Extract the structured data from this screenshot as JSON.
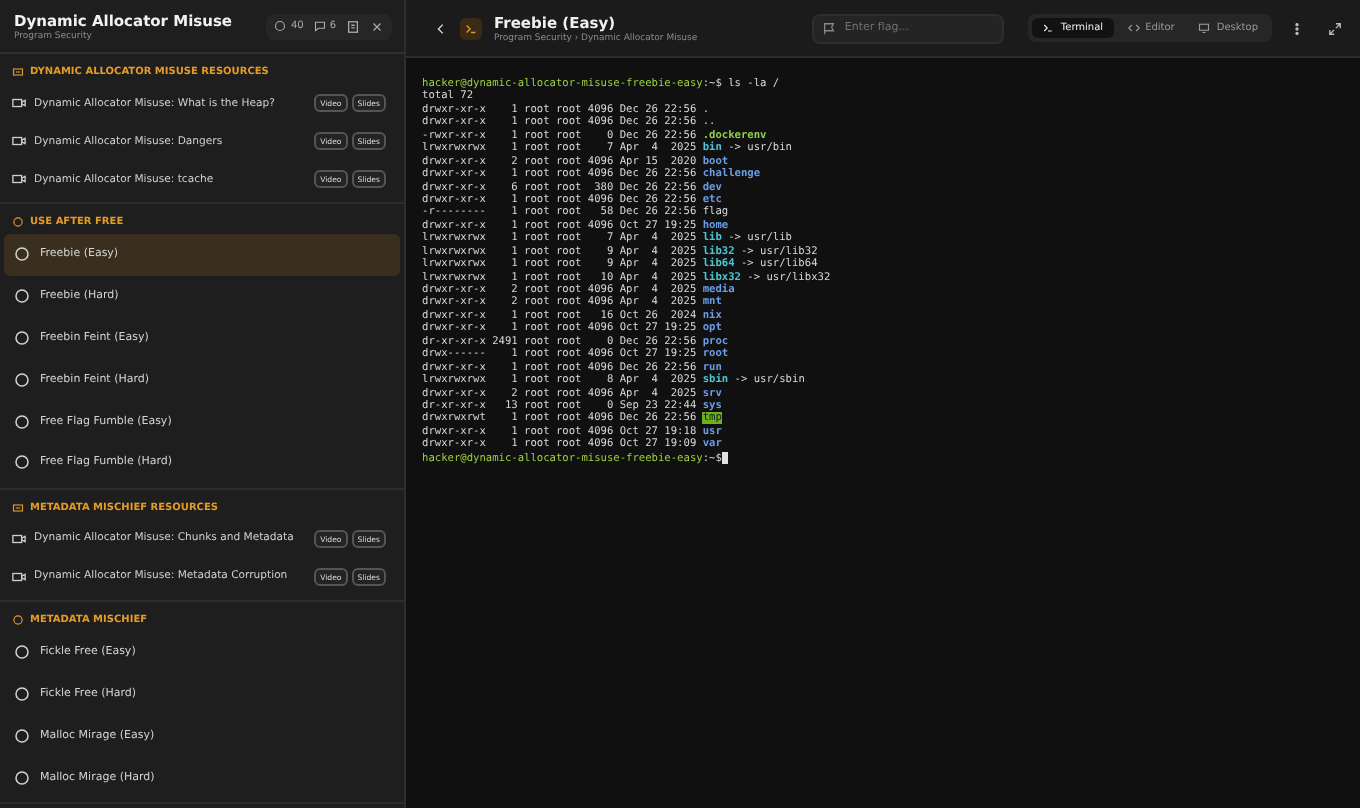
{
  "sidebar": {
    "title": "Dynamic Allocator Misuse",
    "subtitle": "Program Security",
    "stats": [
      {
        "kind": "solved",
        "value": "40"
      },
      {
        "kind": "comments",
        "value": "6"
      }
    ],
    "sections": [
      {
        "kind": "resources",
        "title": "DYNAMIC ALLOCATOR MISUSE RESOURCES",
        "items": [
          {
            "title": "Dynamic Allocator Misuse: What is the Heap?",
            "tags": [
              "Video",
              "Slides"
            ]
          },
          {
            "title": "Dynamic Allocator Misuse: Dangers",
            "tags": [
              "Video",
              "Slides"
            ]
          },
          {
            "title": "Dynamic Allocator Misuse: tcache",
            "tags": [
              "Video",
              "Slides"
            ]
          }
        ]
      },
      {
        "kind": "challenges",
        "title": "USE AFTER FREE",
        "items": [
          {
            "title": "Freebie (Easy)",
            "selected": true
          },
          {
            "title": "Freebie (Hard)",
            "selected": false
          },
          {
            "title": "Freebin Feint (Easy)",
            "selected": false
          },
          {
            "title": "Freebin Feint (Hard)",
            "selected": false
          },
          {
            "title": "Free Flag Fumble (Easy)",
            "selected": false
          },
          {
            "title": "Free Flag Fumble (Hard)",
            "selected": false
          }
        ]
      },
      {
        "kind": "resources",
        "title": "METADATA MISCHIEF RESOURCES",
        "items": [
          {
            "title": "Dynamic Allocator Misuse: Chunks and Metadata",
            "tags": [
              "Video",
              "Slides"
            ]
          },
          {
            "title": "Dynamic Allocator Misuse: Metadata Corruption",
            "tags": [
              "Video",
              "Slides"
            ]
          }
        ]
      },
      {
        "kind": "challenges",
        "title": "METADATA MISCHIEF",
        "items": [
          {
            "title": "Fickle Free (Easy)",
            "selected": false
          },
          {
            "title": "Fickle Free (Hard)",
            "selected": false
          },
          {
            "title": "Malloc Mirage (Easy)",
            "selected": false
          },
          {
            "title": "Malloc Mirage (Hard)",
            "selected": false
          }
        ]
      }
    ]
  },
  "header": {
    "title": "Freebie (Easy)",
    "breadcrumb": "Program Security › Dynamic Allocator Misuse",
    "flag": {
      "placeholder": "Enter flag..."
    },
    "tabs": [
      {
        "kind": "terminal",
        "label": "Terminal",
        "selected": true
      },
      {
        "kind": "editor",
        "label": "Editor",
        "selected": false
      },
      {
        "kind": "desktop",
        "label": "Desktop",
        "selected": false
      }
    ]
  },
  "terminal": {
    "lines": [
      {
        "kind": "prompt",
        "user": "hacker@dynamic-allocator-misuse-freebie-easy",
        "path": ":~$",
        "command": " ls -la /"
      },
      {
        "kind": "text",
        "text": "total 72"
      },
      {
        "kind": "entry",
        "meta": "drwxr-xr-x    1 root root 4096 Dec 26 22:56",
        "name": "."
      },
      {
        "kind": "entry",
        "meta": "drwxr-xr-x    1 root root 4096 Dec 26 22:56",
        "name": ".."
      },
      {
        "kind": "entry",
        "meta": "-rwxr-xr-x    1 root root    0 Dec 26 22:56",
        "name": ".dockerenv",
        "color": "#8fd14a"
      },
      {
        "kind": "entry",
        "meta": "lrwxrwxrwx    1 root root    7 Apr  4  2025",
        "name": "bin",
        "color": "#4cc6d6",
        "target": "-> usr/bin"
      },
      {
        "kind": "entry",
        "meta": "drwxr-xr-x    2 root root 4096 Apr 15  2020",
        "name": "boot",
        "color": "#6b9de8"
      },
      {
        "kind": "entry",
        "meta": "drwxr-xr-x    1 root root 4096 Dec 26 22:56",
        "name": "challenge",
        "color": "#6b9de8"
      },
      {
        "kind": "entry",
        "meta": "drwxr-xr-x    6 root root  380 Dec 26 22:56",
        "name": "dev",
        "color": "#6b9de8"
      },
      {
        "kind": "entry",
        "meta": "drwxr-xr-x    1 root root 4096 Dec 26 22:56",
        "name": "etc",
        "color": "#6b9de8"
      },
      {
        "kind": "entry",
        "meta": "-r--------    1 root root   58 Dec 26 22:56",
        "name": "flag"
      },
      {
        "kind": "entry",
        "meta": "drwxr-xr-x    1 root root 4096 Oct 27 19:25",
        "name": "home",
        "color": "#6b9de8"
      },
      {
        "kind": "entry",
        "meta": "lrwxrwxrwx    1 root root    7 Apr  4  2025",
        "name": "lib",
        "color": "#4cc6d6",
        "target": "-> usr/lib"
      },
      {
        "kind": "entry",
        "meta": "lrwxrwxrwx    1 root root    9 Apr  4  2025",
        "name": "lib32",
        "color": "#4cc6d6",
        "target": "-> usr/lib32"
      },
      {
        "kind": "entry",
        "meta": "lrwxrwxrwx    1 root root    9 Apr  4  2025",
        "name": "lib64",
        "color": "#4cc6d6",
        "target": "-> usr/lib64"
      },
      {
        "kind": "entry",
        "meta": "lrwxrwxrwx    1 root root   10 Apr  4  2025",
        "name": "libx32",
        "color": "#4cc6d6",
        "target": "-> usr/libx32"
      },
      {
        "kind": "entry",
        "meta": "drwxr-xr-x    2 root root 4096 Apr  4  2025",
        "name": "media",
        "color": "#6b9de8"
      },
      {
        "kind": "entry",
        "meta": "drwxr-xr-x    2 root root 4096 Apr  4  2025",
        "name": "mnt",
        "color": "#6b9de8"
      },
      {
        "kind": "entry",
        "meta": "drwxr-xr-x    1 root root   16 Oct 26  2024",
        "name": "nix",
        "color": "#6b9de8"
      },
      {
        "kind": "entry",
        "meta": "drwxr-xr-x    1 root root 4096 Oct 27 19:25",
        "name": "opt",
        "color": "#6b9de8"
      },
      {
        "kind": "entry",
        "meta": "dr-xr-xr-x 2491 root root    0 Dec 26 22:56",
        "name": "proc",
        "color": "#6b9de8"
      },
      {
        "kind": "entry",
        "meta": "drwx------    1 root root 4096 Oct 27 19:25",
        "name": "root",
        "color": "#6b9de8"
      },
      {
        "kind": "entry",
        "meta": "drwxr-xr-x    1 root root 4096 Dec 26 22:56",
        "name": "run",
        "color": "#6b9de8"
      },
      {
        "kind": "entry",
        "meta": "lrwxrwxrwx    1 root root    8 Apr  4  2025",
        "name": "sbin",
        "color": "#4cc6d6",
        "target": "-> usr/sbin"
      },
      {
        "kind": "entry",
        "meta": "drwxr-xr-x    2 root root 4096 Apr  4  2025",
        "name": "srv",
        "color": "#6b9de8"
      },
      {
        "kind": "entry",
        "meta": "dr-xr-xr-x   13 root root    0 Sep 23 22:44",
        "name": "sys",
        "color": "#6b9de8"
      },
      {
        "kind": "entry",
        "meta": "drwxrwxrwt    1 root root 4096 Dec 26 22:56",
        "name": "tmp",
        "color": "#6fae1c",
        "highlighted": true
      },
      {
        "kind": "entry",
        "meta": "drwxr-xr-x    1 root root 4096 Oct 27 19:18",
        "name": "usr",
        "color": "#6b9de8"
      },
      {
        "kind": "entry",
        "meta": "drwxr-xr-x    1 root root 4096 Oct 27 19:09",
        "name": "var",
        "color": "#6b9de8"
      },
      {
        "kind": "prompt",
        "user": "hacker@dynamic-allocator-misuse-freebie-easy",
        "path": ":~$",
        "cursor": true
      }
    ]
  }
}
